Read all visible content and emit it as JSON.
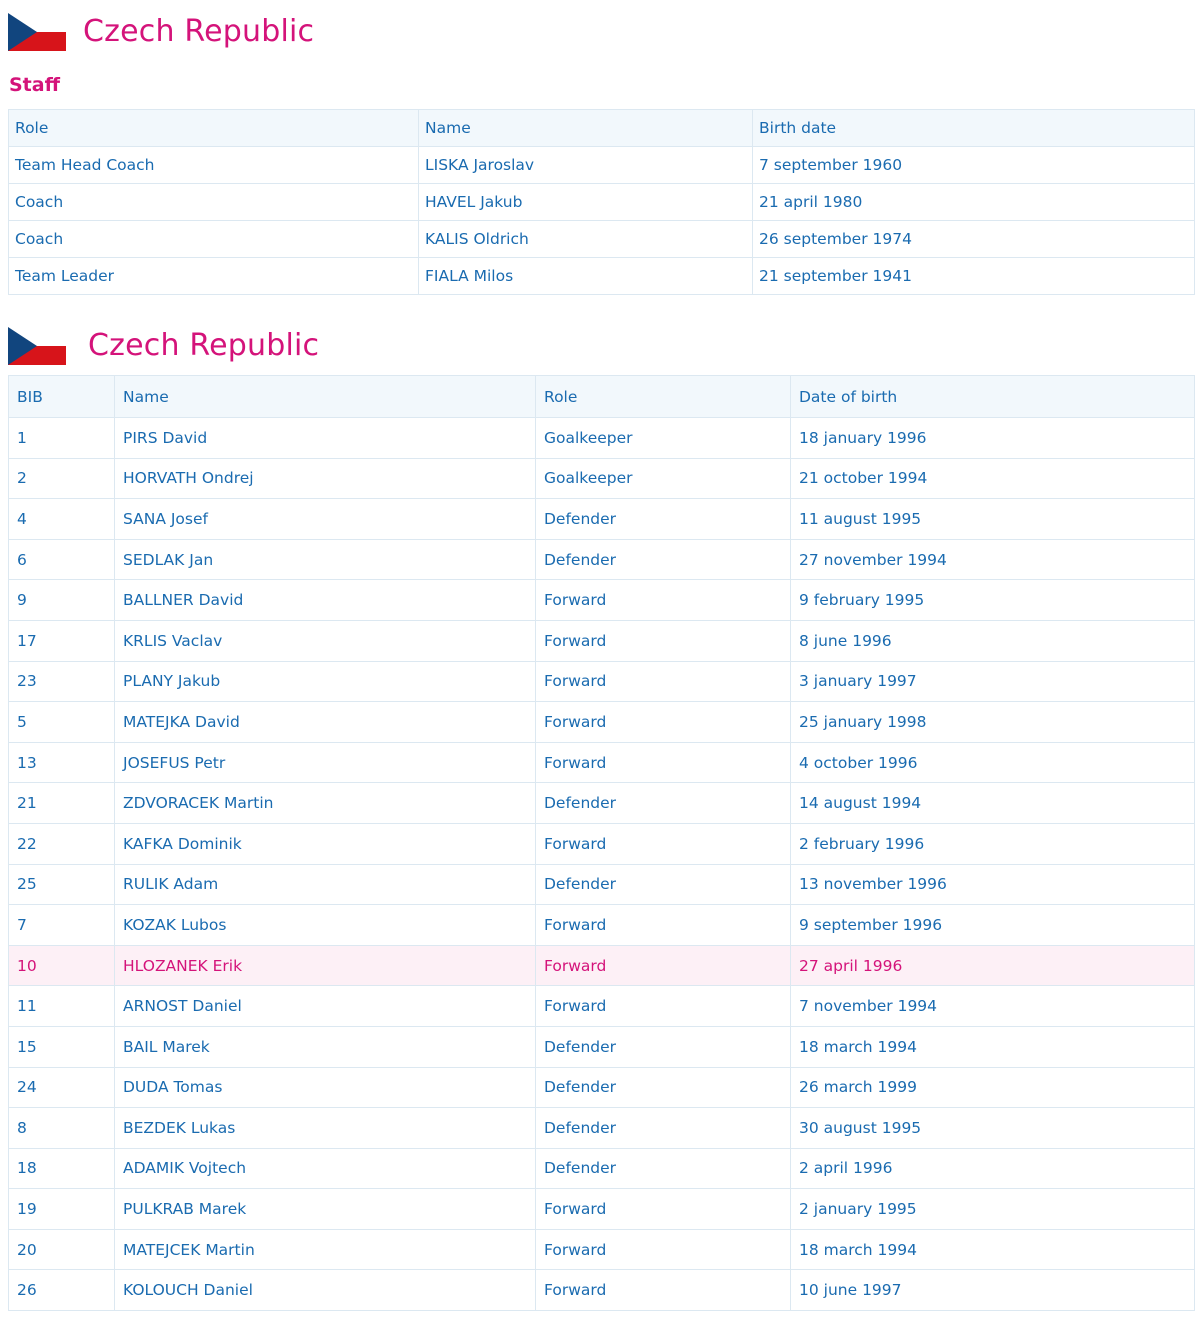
{
  "staff_section": {
    "country": "Czech Republic",
    "heading": "Staff",
    "columns": [
      "Role",
      "Name",
      "Birth date"
    ],
    "rows": [
      [
        "Team Head Coach",
        "LISKA Jaroslav",
        "7 september 1960"
      ],
      [
        "Coach",
        "HAVEL Jakub",
        "21 april 1980"
      ],
      [
        "Coach",
        "KALIS Oldrich",
        "26 september 1974"
      ],
      [
        "Team Leader",
        "FIALA Milos",
        "21 september 1941"
      ]
    ]
  },
  "players_section": {
    "country": "Czech Republic",
    "columns": [
      "BIB",
      "Name",
      "Role",
      "Date of birth"
    ],
    "rows": [
      [
        "1",
        "PIRS David",
        "Goalkeeper",
        "18 january 1996"
      ],
      [
        "2",
        "HORVATH Ondrej",
        "Goalkeeper",
        "21 october 1994"
      ],
      [
        "4",
        "SANA Josef",
        "Defender",
        "11 august 1995"
      ],
      [
        "6",
        "SEDLAK Jan",
        "Defender",
        "27 november 1994"
      ],
      [
        "9",
        "BALLNER David",
        "Forward",
        "9 february 1995"
      ],
      [
        "17",
        "KRLIS Vaclav",
        "Forward",
        "8 june 1996"
      ],
      [
        "23",
        "PLANY Jakub",
        "Forward",
        "3 january 1997"
      ],
      [
        "5",
        "MATEJKA David",
        "Forward",
        "25 january 1998"
      ],
      [
        "13",
        "JOSEFUS Petr",
        "Forward",
        "4 october 1996"
      ],
      [
        "21",
        "ZDVORACEK Martin",
        "Defender",
        "14 august 1994"
      ],
      [
        "22",
        "KAFKA Dominik",
        "Forward",
        "2 february 1996"
      ],
      [
        "25",
        "RULIK Adam",
        "Defender",
        "13 november 1996"
      ],
      [
        "7",
        "KOZAK Lubos",
        "Forward",
        "9 september 1996"
      ],
      [
        "10",
        "HLOZANEK Erik",
        "Forward",
        "27 april 1996"
      ],
      [
        "11",
        "ARNOST Daniel",
        "Forward",
        "7 november 1994"
      ],
      [
        "15",
        "BAIL Marek",
        "Defender",
        "18 march 1994"
      ],
      [
        "24",
        "DUDA Tomas",
        "Defender",
        "26 march 1999"
      ],
      [
        "8",
        "BEZDEK Lukas",
        "Defender",
        "30 august 1995"
      ],
      [
        "18",
        "ADAMIK Vojtech",
        "Defender",
        "2 april 1996"
      ],
      [
        "19",
        "PULKRAB Marek",
        "Forward",
        "2 january 1995"
      ],
      [
        "20",
        "MATEJCEK Martin",
        "Forward",
        "18 march 1994"
      ],
      [
        "26",
        "KOLOUCH Daniel",
        "Forward",
        "10 june 1997"
      ]
    ],
    "highlighted_row": 13
  },
  "icons": {
    "flag": "czech-flag-icon"
  },
  "colors": {
    "accent": "#d4137a",
    "text": "#1a6bb0",
    "border": "#dce8f1",
    "header_bg": "#f2f8fc",
    "highlight_bg": "#fdf0f6",
    "flag_white": "#ffffff",
    "flag_red": "#d7141a",
    "flag_blue": "#11457e"
  }
}
